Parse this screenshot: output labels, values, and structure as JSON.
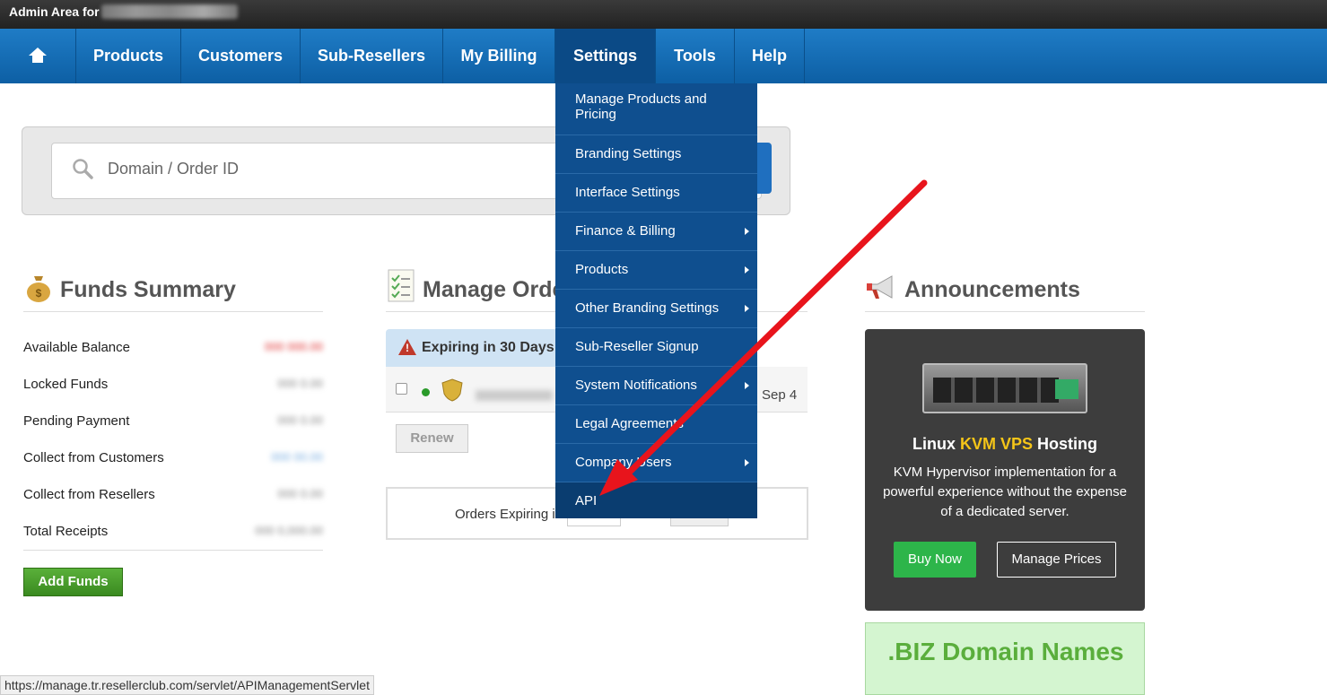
{
  "topbar": {
    "title": "Admin Area for"
  },
  "nav": {
    "items": [
      {
        "label": "Products"
      },
      {
        "label": "Customers"
      },
      {
        "label": "Sub-Resellers"
      },
      {
        "label": "My Billing"
      },
      {
        "label": "Settings"
      },
      {
        "label": "Tools"
      },
      {
        "label": "Help"
      }
    ],
    "active": "Settings"
  },
  "search": {
    "placeholder": "Domain / Order ID"
  },
  "funds": {
    "title": "Funds Summary",
    "rows": [
      {
        "label": "Available Balance"
      },
      {
        "label": "Locked Funds"
      },
      {
        "label": "Pending Payment"
      },
      {
        "label": "Collect from Customers"
      },
      {
        "label": "Collect from Resellers"
      },
      {
        "label": "Total Receipts"
      }
    ],
    "add_funds": "Add Funds"
  },
  "orders": {
    "title": "Manage Orde",
    "expiring": "Expiring in 30 Days",
    "row_date": "Sep 4",
    "renew": "Renew",
    "expiring_label": "Orders Expiring i"
  },
  "settings_menu": {
    "items": [
      {
        "label": "Manage Products and Pricing",
        "submenu": false
      },
      {
        "label": "Branding Settings",
        "submenu": false
      },
      {
        "label": "Interface Settings",
        "submenu": false
      },
      {
        "label": "Finance & Billing",
        "submenu": true
      },
      {
        "label": "Products",
        "submenu": true
      },
      {
        "label": "Other Branding Settings",
        "submenu": true
      },
      {
        "label": "Sub-Reseller Signup",
        "submenu": false
      },
      {
        "label": "System Notifications",
        "submenu": true
      },
      {
        "label": "Legal Agreements",
        "submenu": false
      },
      {
        "label": "Company Users",
        "submenu": true
      },
      {
        "label": "API",
        "submenu": false
      }
    ],
    "highlighted": "API"
  },
  "announcements": {
    "title": "Announcements",
    "promo": {
      "heading_pre": "Linux ",
      "heading_hl": "KVM VPS",
      "heading_post": " Hosting",
      "description": "KVM Hypervisor implementation for a powerful experience without the expense of a dedicated server.",
      "buy_now": "Buy Now",
      "manage_prices": "Manage Prices"
    },
    "biz": ".BIZ Domain Names"
  },
  "statusbar": {
    "url": "https://manage.tr.resellerclub.com/servlet/APIManagementServlet"
  },
  "colors": {
    "nav": "#0d5fa4",
    "menu": "#0f4f8f",
    "accent_green": "#2db54a",
    "arrow": "#e8141c"
  }
}
